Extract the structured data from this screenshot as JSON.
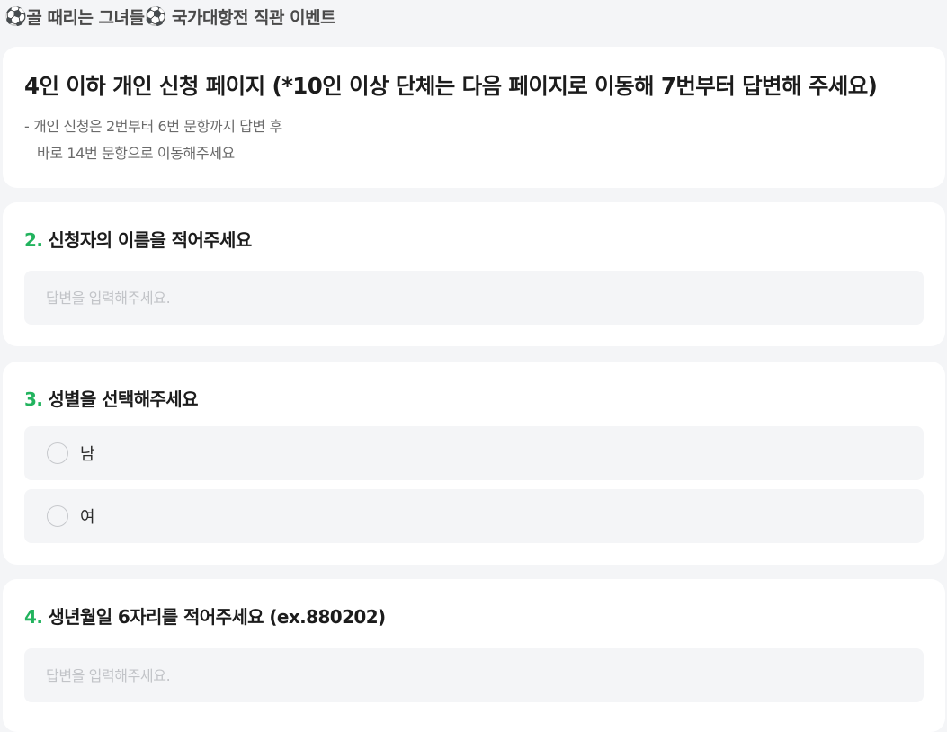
{
  "header": {
    "title_prefix_icon": "⚽",
    "title_text": "골 때리는 그녀들",
    "title_mid_icon": "⚽",
    "title_suffix": " 국가대항전 직관 이벤트"
  },
  "intro": {
    "title": "4인 이하 개인 신청 페이지 (*10인 이상 단체는 다음 페이지로 이동해 7번부터 답변해 주세요)",
    "description": "- 개인 신청은 2번부터 6번 문항까지 답변 후\n   바로 14번 문항으로 이동해주세요"
  },
  "questions": [
    {
      "number": "2.",
      "title": "신청자의 이름을 적어주세요",
      "placeholder": "답변을 입력해주세요."
    },
    {
      "number": "3.",
      "title": "성별을 선택해주세요",
      "options": [
        "남",
        "여"
      ]
    },
    {
      "number": "4.",
      "title": "생년월일 6자리를 적어주세요 (ex.880202)",
      "placeholder": "답변을 입력해주세요."
    }
  ],
  "colors": {
    "accent_green": "#22b35e",
    "page_background": "#f4f5f7",
    "card_background": "#ffffff"
  }
}
